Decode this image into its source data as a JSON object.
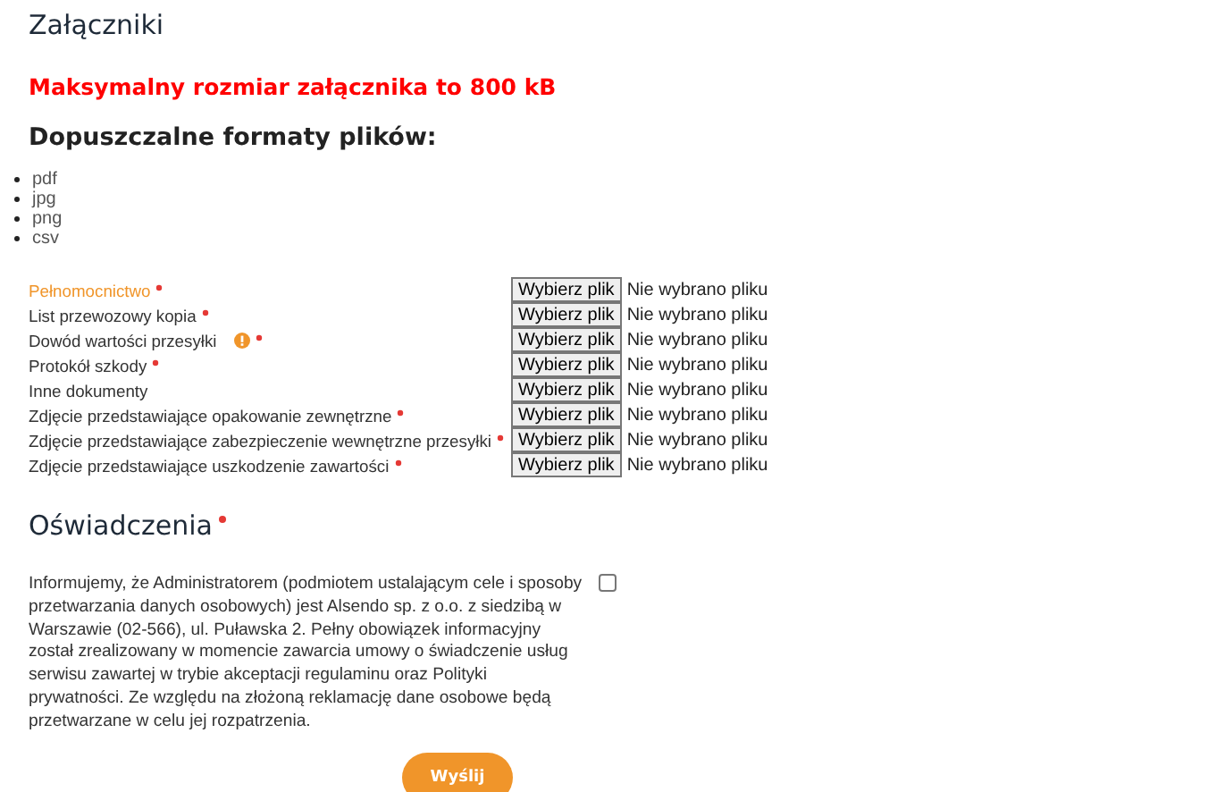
{
  "section_title": "Załączniki",
  "size_notice": "Maksymalny rozmiar załącznika to 800 kB",
  "formats_heading": "Dopuszczalne formaty plików:",
  "formats": [
    "pdf",
    "jpg",
    "png",
    "csv"
  ],
  "attachments": [
    {
      "label": "Pełnomocnictwo",
      "required": true,
      "info": false,
      "highlighted": true,
      "button": "Wybierz plik",
      "status": "Nie wybrano pliku"
    },
    {
      "label": "List przewozowy kopia",
      "required": true,
      "info": false,
      "highlighted": false,
      "button": "Wybierz plik",
      "status": "Nie wybrano pliku"
    },
    {
      "label": "Dowód wartości przesyłki",
      "required": true,
      "info": true,
      "highlighted": false,
      "button": "Wybierz plik",
      "status": "Nie wybrano pliku"
    },
    {
      "label": "Protokół szkody",
      "required": true,
      "info": false,
      "highlighted": false,
      "button": "Wybierz plik",
      "status": "Nie wybrano pliku"
    },
    {
      "label": "Inne dokumenty",
      "required": false,
      "info": false,
      "highlighted": false,
      "button": "Wybierz plik",
      "status": "Nie wybrano pliku"
    },
    {
      "label": "Zdjęcie przedstawiające opakowanie zewnętrzne",
      "required": true,
      "info": false,
      "highlighted": false,
      "button": "Wybierz plik",
      "status": "Nie wybrano pliku"
    },
    {
      "label": "Zdjęcie przedstawiające zabezpieczenie wewnętrzne przesyłki",
      "required": true,
      "info": false,
      "highlighted": false,
      "button": "Wybierz plik",
      "status": "Nie wybrano pliku"
    },
    {
      "label": "Zdjęcie przedstawiające uszkodzenie zawartości",
      "required": true,
      "info": false,
      "highlighted": false,
      "button": "Wybierz plik",
      "status": "Nie wybrano pliku"
    }
  ],
  "declarations": {
    "title": "Oświadczenia",
    "required": true,
    "text": "Informujemy, że Administratorem (podmiotem ustalającym cele i sposoby przetwarzania danych osobowych) jest Alsendo sp. z o.o. z siedzibą w Warszawie (02-566), ul. Puławska 2. Pełny obowiązek informacyjny został zrealizowany w momencie zawarcia umowy o świadczenie usług serwisu zawartej w trybie akceptacji regulaminu oraz Polityki prywatności. Ze względu na złożoną reklamację dane osobowe będą przetwarzane w celu jej rozpatrzenia.",
    "checked": false
  },
  "submit": "Wyślij"
}
